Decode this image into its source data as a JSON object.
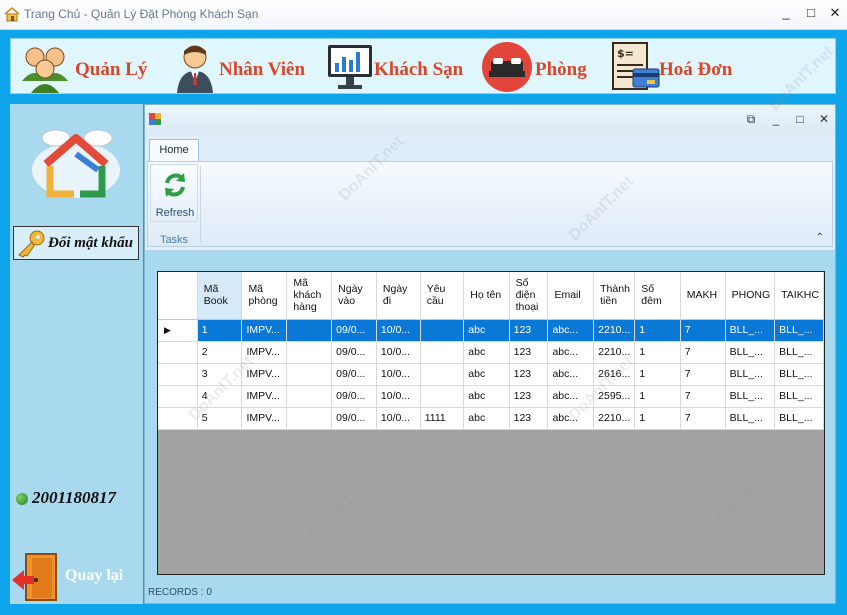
{
  "window": {
    "title": "Trang Chủ - Quản Lý Đặt Phòng Khách Sạn",
    "minimize_glyph": "_",
    "maximize_glyph": "□",
    "close_glyph": "✕"
  },
  "menu": [
    {
      "label": "Quản Lý",
      "icon": "users-group-icon"
    },
    {
      "label": "Nhân Viên",
      "icon": "staff-icon"
    },
    {
      "label": "Khách Sạn",
      "icon": "monitor-chart-icon"
    },
    {
      "label": "Phòng",
      "icon": "bed-icon"
    },
    {
      "label": "Hoá Đơn",
      "icon": "invoice-icon"
    }
  ],
  "sidebar": {
    "change_password": "Đổi mật khẩu",
    "user_id": "2001180817",
    "back": "Quay lại"
  },
  "child": {
    "tab": "Home",
    "refresh": "Refresh",
    "group": "Tasks",
    "collapse_glyph": "⌃",
    "status": "RECORDS : 0"
  },
  "grid": {
    "columns": [
      "Mã Book",
      "Mã phòng",
      "Mã khách hàng",
      "Ngày vào",
      "Ngày đi",
      "Yêu cầu",
      "Họ tên",
      "Số điện thoại",
      "Email",
      "Thành tiền",
      "Số đêm",
      "MAKH",
      "PHONG",
      "TAIKHC"
    ],
    "rows": [
      [
        "1",
        "IMPV...",
        "",
        "09/0...",
        "10/0...",
        "",
        "abc",
        "123",
        "abc...",
        "2210...",
        "1",
        "7",
        "BLL_...",
        "BLL_..."
      ],
      [
        "2",
        "IMPV...",
        "",
        "09/0...",
        "10/0...",
        "",
        "abc",
        "123",
        "abc...",
        "2210...",
        "1",
        "7",
        "BLL_...",
        "BLL_..."
      ],
      [
        "3",
        "IMPV...",
        "",
        "09/0...",
        "10/0...",
        "",
        "abc",
        "123",
        "abc...",
        "2616...",
        "1",
        "7",
        "BLL_...",
        "BLL_..."
      ],
      [
        "4",
        "IMPV...",
        "",
        "09/0...",
        "10/0...",
        "",
        "abc",
        "123",
        "abc...",
        "2595...",
        "1",
        "7",
        "BLL_...",
        "BLL_..."
      ],
      [
        "5",
        "IMPV...",
        "",
        "09/0...",
        "10/0...",
        "1111",
        "abc",
        "123",
        "abc...",
        "2210...",
        "1",
        "7",
        "BLL_...",
        "BLL_..."
      ]
    ],
    "selected_row": 0
  },
  "colors": {
    "background": "#0ea5ea",
    "menu_text": "#d9462a",
    "selection": "#0a78d7"
  }
}
